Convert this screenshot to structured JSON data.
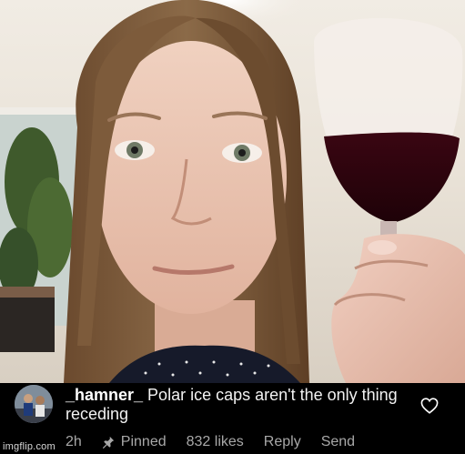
{
  "comment": {
    "username": "_hamner_",
    "text": "Polar ice caps aren't the only thing receding",
    "time": "2h",
    "pinned_label": "Pinned",
    "likes": "832 likes",
    "reply_label": "Reply",
    "send_label": "Send"
  },
  "watermark": "imgflip.com",
  "icons": {
    "like": "heart-outline-icon",
    "pin": "pushpin-icon"
  },
  "colors": {
    "background": "#000000",
    "meta_text": "#a8a8a8",
    "comment_text": "#f2f2f2"
  }
}
